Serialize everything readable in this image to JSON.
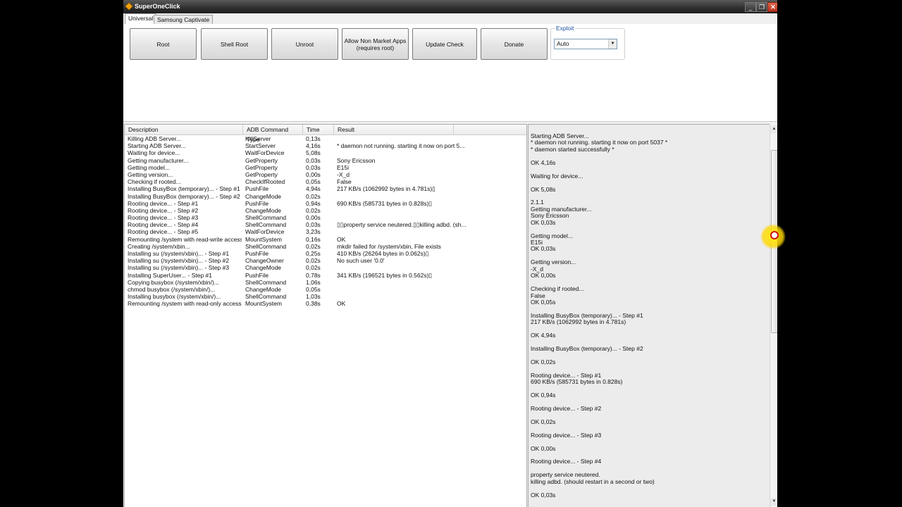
{
  "window": {
    "title": "SuperOneClick",
    "minimize_glyph": "_",
    "restore_glyph": "❐",
    "close_glyph": "✕",
    "app_icon": "diamond-icon"
  },
  "tabs": [
    {
      "label": "Universal",
      "active": true
    },
    {
      "label": "Samsung Captivate",
      "active": false
    }
  ],
  "buttons": {
    "root": "Root",
    "shell_root": "Shell Root",
    "unroot": "Unroot",
    "allow_non_market": "Allow Non Market Apps\n(requires root)",
    "update_check": "Update Check",
    "donate": "Donate"
  },
  "exploit": {
    "label": "Exploit",
    "selected": "Auto"
  },
  "table": {
    "headers": {
      "description": "Description",
      "command": "ADB Command Type",
      "time": "Time",
      "result": "Result"
    },
    "rows": [
      {
        "description": "Killing ADB Server...",
        "command": "KillServer",
        "time": "0,13s",
        "result": ""
      },
      {
        "description": "Starting ADB Server...",
        "command": "StartServer",
        "time": "4,16s",
        "result": "* daemon not running. starting it now on port 5..."
      },
      {
        "description": "Waiting for device...",
        "command": "WaitForDevice",
        "time": "5,08s",
        "result": ""
      },
      {
        "description": "Getting manufacturer...",
        "command": "GetProperty",
        "time": "0,03s",
        "result": "Sony Ericsson"
      },
      {
        "description": "Getting model...",
        "command": "GetProperty",
        "time": "0,03s",
        "result": "E15i"
      },
      {
        "description": "Getting version...",
        "command": "GetProperty",
        "time": "0,00s",
        "result": "-X_d"
      },
      {
        "description": "Checking if rooted...",
        "command": "CheckIfRooted",
        "time": "0,05s",
        "result": "False"
      },
      {
        "description": "Installing BusyBox (temporary)... - Step #1",
        "command": "PushFile",
        "time": "4,94s",
        "result": "217 KB/s (1062992 bytes in 4.781s)▯"
      },
      {
        "description": "Installing BusyBox (temporary)... - Step #2",
        "command": "ChangeMode",
        "time": "0,02s",
        "result": ""
      },
      {
        "description": "Rooting device... - Step #1",
        "command": "PushFile",
        "time": "0,94s",
        "result": "690 KB/s (585731 bytes in 0.828s)▯"
      },
      {
        "description": "Rooting device... - Step #2",
        "command": "ChangeMode",
        "time": "0,02s",
        "result": ""
      },
      {
        "description": "Rooting device... - Step #3",
        "command": "ShellCommand",
        "time": "0,00s",
        "result": ""
      },
      {
        "description": "Rooting device... - Step #4",
        "command": "ShellCommand",
        "time": "0,03s",
        "result": "▯▯property service neutered.▯▯killing adbd. (sh..."
      },
      {
        "description": "Rooting device... - Step #5",
        "command": "WaitForDevice",
        "time": "3,23s",
        "result": ""
      },
      {
        "description": "Remounting /system with read-write access...",
        "command": "MountSystem",
        "time": "0,16s",
        "result": "OK"
      },
      {
        "description": "Creating /system/xbin...",
        "command": "ShellCommand",
        "time": "0,02s",
        "result": "mkdir failed for /system/xbin, File exists"
      },
      {
        "description": "Installing su (/system/xbin)... - Step #1",
        "command": "PushFile",
        "time": "0,25s",
        "result": "410 KB/s (26264 bytes in 0.062s)▯"
      },
      {
        "description": "Installing su (/system/xbin)... - Step #2",
        "command": "ChangeOwner",
        "time": "0,02s",
        "result": "No such user '0.0'"
      },
      {
        "description": "Installing su (/system/xbin)... - Step #3",
        "command": "ChangeMode",
        "time": "0,02s",
        "result": ""
      },
      {
        "description": "Installing SuperUser... - Step #1",
        "command": "PushFile",
        "time": "0,78s",
        "result": "341 KB/s (196521 bytes in 0.562s)▯"
      },
      {
        "description": "Copying busybox (/system/xbin/)...",
        "command": "ShellCommand",
        "time": "1,06s",
        "result": ""
      },
      {
        "description": "chmod busybox (/system/xbin/)...",
        "command": "ChangeMode",
        "time": "0,05s",
        "result": ""
      },
      {
        "description": "Installing busybox (/system/xbin/)...",
        "command": "ShellCommand",
        "time": "1,03s",
        "result": ""
      },
      {
        "description": "Remounting /system with read-only access...",
        "command": "MountSystem",
        "time": "0,38s",
        "result": "OK"
      }
    ]
  },
  "log": [
    "Starting ADB Server...",
    "* daemon not running. starting it now on port 5037 *",
    "* daemon started successfully *",
    "",
    "OK 4,16s",
    "",
    "Waiting for device...",
    "",
    "OK 5,08s",
    "",
    "2.1.1",
    "Getting manufacturer...",
    "Sony Ericsson",
    "OK 0,03s",
    "",
    "Getting model...",
    "E15i",
    "OK 0,03s",
    "",
    "Getting version...",
    "-X_d",
    "OK 0,00s",
    "",
    "Checking if rooted...",
    "False",
    "OK 0,05s",
    "",
    "Installing BusyBox (temporary)... - Step #1",
    "217 KB/s (1062992 bytes in 4.781s)",
    "",
    "OK 4,94s",
    "",
    "Installing BusyBox (temporary)... - Step #2",
    "",
    "OK 0,02s",
    "",
    "Rooting device... - Step #1",
    "690 KB/s (585731 bytes in 0.828s)",
    "",
    "OK 0,94s",
    "",
    "Rooting device... - Step #2",
    "",
    "OK 0,02s",
    "",
    "Rooting device... - Step #3",
    "",
    "OK 0,00s",
    "",
    "Rooting device... - Step #4",
    "",
    "property service neutered.",
    "killing adbd. (should restart in a second or two)",
    "",
    "OK 0,03s"
  ],
  "scrollbar": {
    "up_glyph": "▲",
    "down_glyph": "▼"
  }
}
